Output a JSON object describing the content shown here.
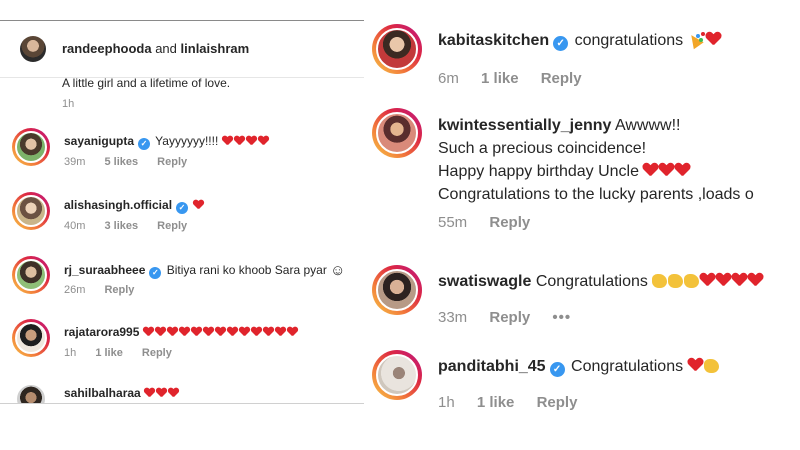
{
  "left": {
    "header": {
      "user_a": "randeephooda",
      "and_word": "and",
      "user_b": "linlaishram"
    },
    "caption": {
      "text": "A little girl and a lifetime of love.",
      "time": "1h"
    },
    "comments": [
      {
        "username": "sayanigupta",
        "verified": true,
        "text": "Yayyyyyy!!!!",
        "hearts": 4,
        "time": "39m",
        "likes": "5 likes",
        "reply": "Reply"
      },
      {
        "username": "alishasingh.official",
        "verified": true,
        "text": "",
        "hearts": 1,
        "time": "40m",
        "likes": "3 likes",
        "reply": "Reply"
      },
      {
        "username": "rj_suraabheee",
        "verified": true,
        "text": "Bitiya rani ko khoob Sara pyar",
        "hearts": 0,
        "time": "26m",
        "likes": "",
        "reply": "Reply"
      },
      {
        "username": "rajatarora995",
        "verified": false,
        "text": "",
        "hearts": 13,
        "time": "1h",
        "likes": "1 like",
        "reply": "Reply"
      },
      {
        "username": "sahilbalharaa",
        "verified": false,
        "text": "",
        "hearts": 3,
        "time": "",
        "likes": "",
        "reply": ""
      }
    ]
  },
  "right": {
    "comments": [
      {
        "username": "kabitaskitchen",
        "verified": true,
        "lines": [
          "congratulations"
        ],
        "time": "6m",
        "likes": "1 like",
        "reply": "Reply"
      },
      {
        "username": "kwintessentially_jenny",
        "verified": false,
        "lines": [
          "Awwww!!",
          "Such a precious coincidence!",
          "Happy happy birthday Uncle",
          "Congratulations to the lucky parents ,loads o"
        ],
        "time": "55m",
        "likes": "",
        "reply": "Reply"
      },
      {
        "username": "swatiswagle",
        "verified": false,
        "lines": [
          "Congratulations"
        ],
        "time": "33m",
        "likes": "",
        "reply": "Reply",
        "more": "•••"
      },
      {
        "username": "panditabhi_45",
        "verified": true,
        "lines": [
          "Congratulations"
        ],
        "time": "1h",
        "likes": "1 like",
        "reply": "Reply"
      }
    ]
  },
  "colors": {
    "accent_blue": "#3897f0",
    "heart_red": "#e0242c",
    "muted_text": "#8e8e8e"
  }
}
